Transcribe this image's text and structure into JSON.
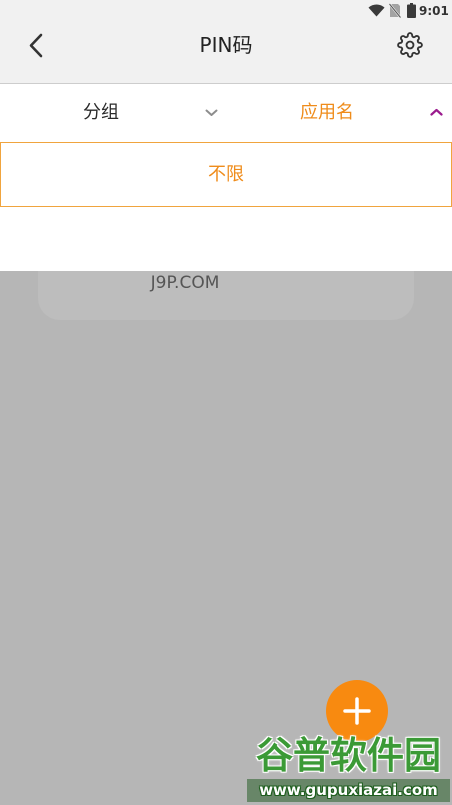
{
  "status_bar": {
    "time": "9:01",
    "icons": [
      "wifi-icon",
      "no-sim-icon",
      "battery-icon"
    ]
  },
  "app_bar": {
    "title": "PIN码",
    "back_icon": "chevron-left-icon",
    "settings_icon": "gear-icon"
  },
  "filter_bar": {
    "group": {
      "label": "分组",
      "icon": "chevron-down-icon",
      "active": false
    },
    "app_name": {
      "label": "应用名",
      "icon": "chevron-up-icon",
      "active": true
    }
  },
  "dropdown": {
    "options": [
      {
        "label": "不限",
        "selected": true
      }
    ]
  },
  "card": {
    "text": "J9P.COM"
  },
  "fab": {
    "icon": "plus-icon"
  },
  "watermark": {
    "name": "谷普软件园",
    "url": "www.gupuxiazai.com"
  },
  "colors": {
    "accent": "#ef8c1b",
    "chevron_active": "#9b1b8e",
    "overlay": "#b6b6b6",
    "fab": "#f88a10"
  }
}
